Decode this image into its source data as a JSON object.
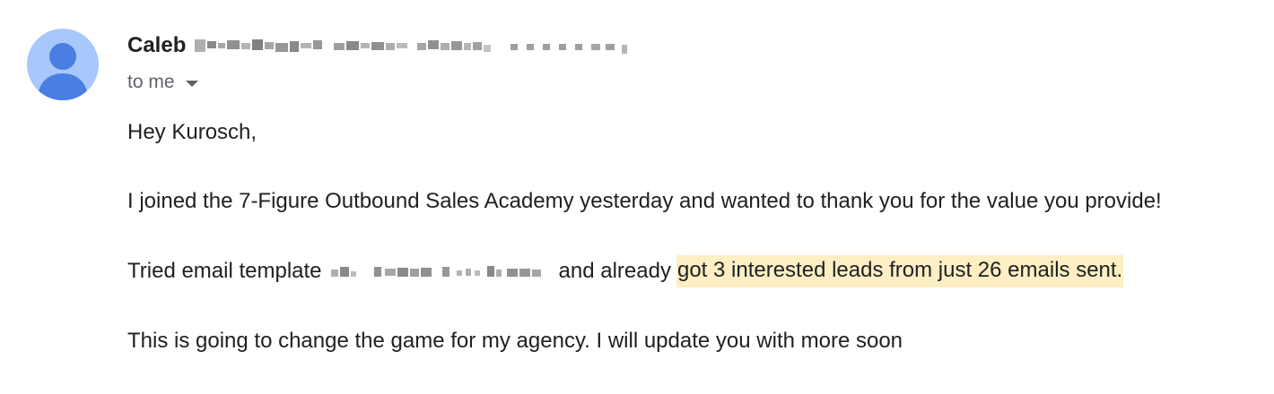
{
  "sender": {
    "name": "Caleb",
    "avatar_icon": "default-person-icon",
    "avatar_color": "#a8c7fa"
  },
  "recipient": {
    "label": "to me",
    "dropdown_icon": "caret-down-icon"
  },
  "body": {
    "greeting": "Hey Kurosch,",
    "paragraph_joined": "I joined the 7-Figure Outbound Sales Academy yesterday and wanted to thank you for the value you provide!",
    "paragraph_template_before": "Tried email template",
    "paragraph_template_middle": "and already",
    "paragraph_template_highlight": "got 3 interested leads from just 26 emails sent.",
    "paragraph_change": "This is going to change the game for my agency. I will update you with more soon"
  },
  "colors": {
    "highlight": "#fdefc3",
    "text": "#202124",
    "muted": "#5f6368"
  }
}
